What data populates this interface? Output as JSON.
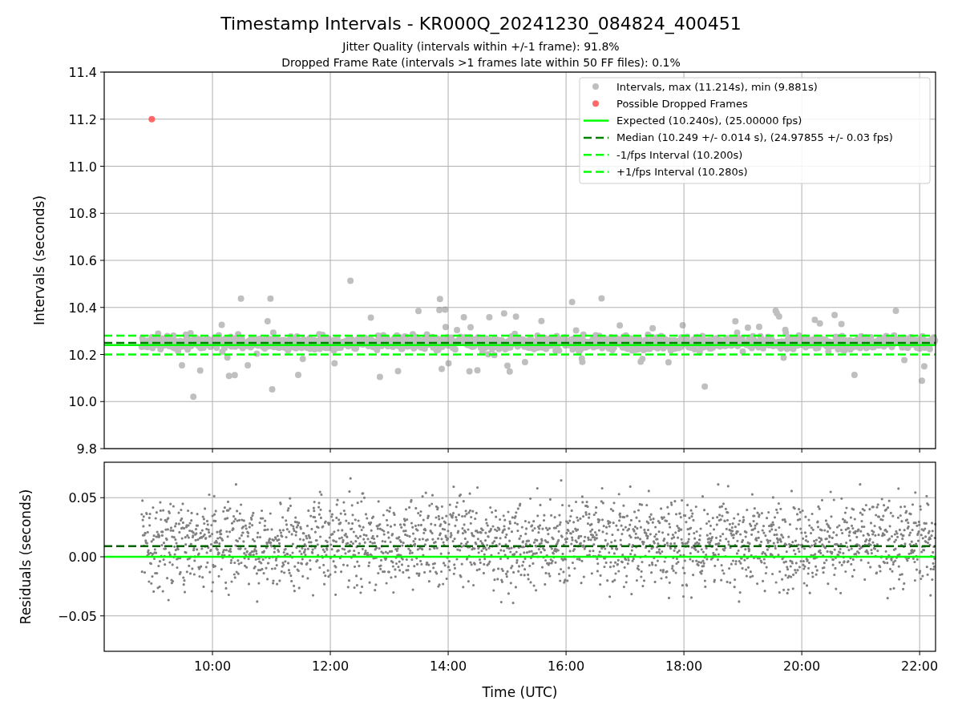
{
  "title": "Timestamp Intervals - KR000Q_20241230_084824_400451",
  "subtitles": [
    "Jitter Quality (intervals within +/-1 frame): 91.8%",
    "Dropped Frame Rate (intervals >1 frames late within 50 FF files): 0.1%"
  ],
  "intervals_panel": {
    "chart_data": {
      "type": "line",
      "ylabel": "Intervals (seconds)",
      "grid": true,
      "legend": "upper right",
      "x": [
        8.163,
        8.97,
        22.27
      ],
      "xlim": [
        8.163,
        22.27
      ],
      "ylim": [
        9.8,
        11.4
      ],
      "yticks": [
        {
          "value": 9.8,
          "label": "9.8"
        },
        {
          "value": 10.0,
          "label": "10.0"
        },
        {
          "value": 10.2,
          "label": "10.2"
        },
        {
          "value": 10.4,
          "label": "10.4"
        },
        {
          "value": 10.6,
          "label": "10.6"
        },
        {
          "value": 10.8,
          "label": "10.8"
        },
        {
          "value": 11.0,
          "label": "11.0"
        },
        {
          "value": 11.2,
          "label": "11.2"
        },
        {
          "value": 11.4,
          "label": "11.4"
        }
      ],
      "series": [
        {
          "name": "Intervals, max (11.214s), min (9.881s)",
          "color": "#808080",
          "line_style": "none",
          "marker": "o",
          "values": [
            null,
            null,
            null
          ]
        },
        {
          "name": "Possible Dropped Frames",
          "color": "#ff4d4d",
          "line_style": "none",
          "marker": "o",
          "values": [
            null,
            11.2,
            null
          ]
        },
        {
          "name": "Expected (10.240s), (25.00000 fps)",
          "color": "#00ff00",
          "line_style": "solid",
          "values": [
            10.24,
            10.24,
            10.24
          ]
        },
        {
          "name": "Median (10.249 +/- 0.014 s), (24.97855 +/- 0.03 fps)",
          "color": "#008000",
          "line_style": "dashed",
          "values": [
            10.249,
            10.249,
            10.249
          ]
        },
        {
          "name": "-1/fps Interval (10.200s)",
          "color": "#00ff00",
          "line_style": "dashed",
          "values": [
            10.2,
            10.2,
            10.2
          ]
        },
        {
          "name": "+1/fps Interval (10.280s)",
          "color": "#00ff00",
          "line_style": "dashed",
          "values": [
            10.28,
            10.28,
            10.28
          ]
        }
      ]
    }
  },
  "residuals_panel": {
    "chart_data": {
      "type": "line",
      "xlabel": "Time (UTC)",
      "ylabel": "Residuals (seconds)",
      "grid": true,
      "xlim": [
        8.163,
        22.27
      ],
      "ylim": [
        -0.08,
        0.08
      ],
      "xticks": [
        {
          "value": 10,
          "label": "10:00"
        },
        {
          "value": 12,
          "label": "12:00"
        },
        {
          "value": 14,
          "label": "14:00"
        },
        {
          "value": 16,
          "label": "16:00"
        },
        {
          "value": 18,
          "label": "18:00"
        },
        {
          "value": 20,
          "label": "20:00"
        },
        {
          "value": 22,
          "label": "22:00"
        }
      ],
      "yticks": [
        {
          "value": -0.05,
          "label": "−0.05"
        },
        {
          "value": 0,
          "label": "0.00"
        },
        {
          "value": 0.05,
          "label": "0.05"
        }
      ],
      "x": [
        8.163,
        22.27
      ],
      "series": [
        {
          "color": "#00ff00",
          "line_style": "solid",
          "values": [
            0,
            0
          ]
        },
        {
          "color": "#006400",
          "line_style": "dashed",
          "values": [
            0.009,
            0.009
          ]
        }
      ]
    }
  }
}
